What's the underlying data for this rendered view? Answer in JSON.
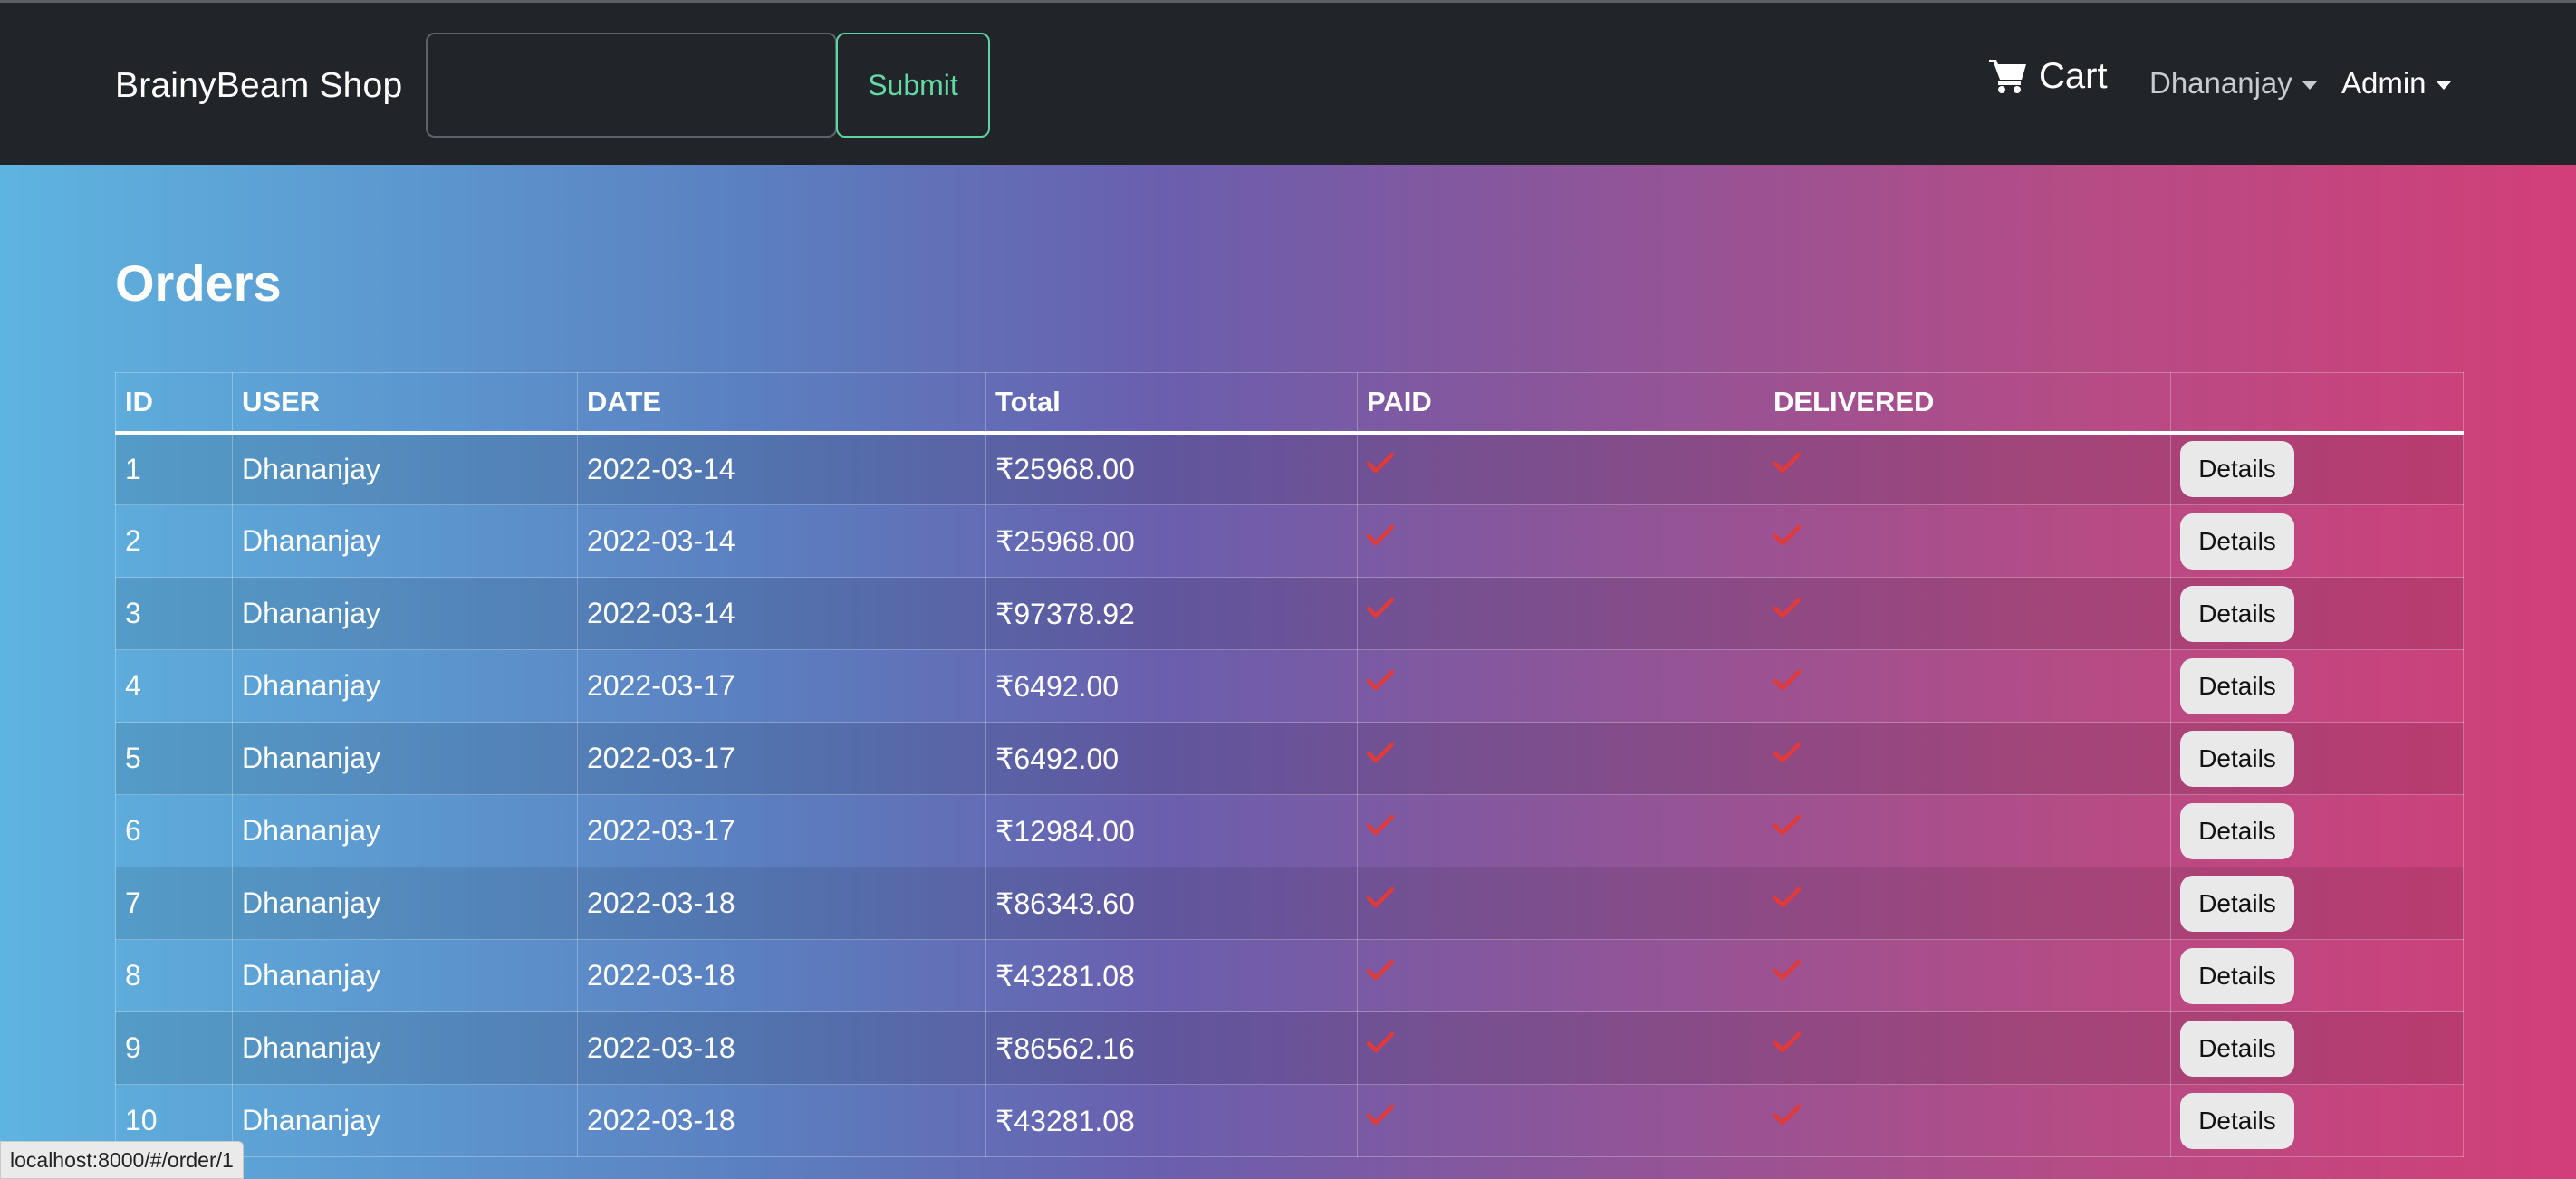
{
  "navbar": {
    "brand": "BrainyBeam Shop",
    "search": {
      "value": "",
      "placeholder": ""
    },
    "submit_label": "Submit",
    "cart_label": "Cart",
    "cart_icon": "shopping-cart-icon",
    "user_menu_label": "Dhananjay",
    "admin_menu_label": "Admin"
  },
  "main": {
    "title": "Orders",
    "table": {
      "headers": [
        "ID",
        "USER",
        "DATE",
        "Total",
        "PAID",
        "DELIVERED",
        ""
      ],
      "rows": [
        {
          "id": "1",
          "user": "Dhananjay",
          "date": "2022-03-14",
          "total": "₹25968.00",
          "paid": true,
          "delivered": true,
          "action": "Details"
        },
        {
          "id": "2",
          "user": "Dhananjay",
          "date": "2022-03-14",
          "total": "₹25968.00",
          "paid": true,
          "delivered": true,
          "action": "Details"
        },
        {
          "id": "3",
          "user": "Dhananjay",
          "date": "2022-03-14",
          "total": "₹97378.92",
          "paid": true,
          "delivered": true,
          "action": "Details"
        },
        {
          "id": "4",
          "user": "Dhananjay",
          "date": "2022-03-17",
          "total": "₹6492.00",
          "paid": true,
          "delivered": true,
          "action": "Details"
        },
        {
          "id": "5",
          "user": "Dhananjay",
          "date": "2022-03-17",
          "total": "₹6492.00",
          "paid": true,
          "delivered": true,
          "action": "Details"
        },
        {
          "id": "6",
          "user": "Dhananjay",
          "date": "2022-03-17",
          "total": "₹12984.00",
          "paid": true,
          "delivered": true,
          "action": "Details"
        },
        {
          "id": "7",
          "user": "Dhananjay",
          "date": "2022-03-18",
          "total": "₹86343.60",
          "paid": true,
          "delivered": true,
          "action": "Details"
        },
        {
          "id": "8",
          "user": "Dhananjay",
          "date": "2022-03-18",
          "total": "₹43281.08",
          "paid": true,
          "delivered": true,
          "action": "Details"
        },
        {
          "id": "9",
          "user": "Dhananjay",
          "date": "2022-03-18",
          "total": "₹86562.16",
          "paid": true,
          "delivered": true,
          "action": "Details"
        },
        {
          "id": "10",
          "user": "Dhananjay",
          "date": "2022-03-18",
          "total": "₹43281.08",
          "paid": true,
          "delivered": true,
          "action": "Details"
        }
      ],
      "status_icon": "check-icon",
      "check_color": "#e03a3a"
    }
  },
  "status_bar": {
    "url": "localhost:8000/#/order/1"
  },
  "colors": {
    "navbar_bg": "#212529",
    "submit_accent": "#5fd3a0",
    "gradient_start": "#5eb4e0",
    "gradient_end": "#d23f78"
  }
}
